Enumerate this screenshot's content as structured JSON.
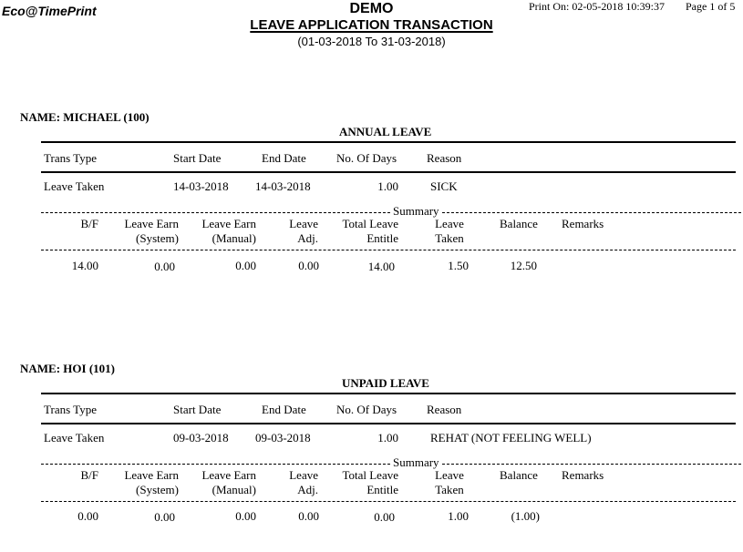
{
  "header": {
    "brand": "Eco@TimePrint",
    "company": "DEMO",
    "title": "LEAVE APPLICATION TRANSACTION",
    "period": "(01-03-2018 To 31-03-2018)",
    "print_on": "Print On: 02-05-2018 10:39:37",
    "page": "Page 1 of 5"
  },
  "columns": {
    "trans_type": "Trans Type",
    "start_date": "Start Date",
    "end_date": "End Date",
    "no_of_days": "No. Of Days",
    "reason": "Reason"
  },
  "summary_columns": {
    "label": "Summary",
    "bf": "B/F",
    "earn_sys_1": "Leave Earn",
    "earn_sys_2": "(System)",
    "earn_man_1": "Leave Earn",
    "earn_man_2": "(Manual)",
    "adj_1": "Leave",
    "adj_2": "Adj.",
    "entitle_1": "Total Leave",
    "entitle_2": "Entitle",
    "taken_1": "Leave",
    "taken_2": "Taken",
    "balance": "Balance",
    "remarks": "Remarks"
  },
  "employees": [
    {
      "name": "NAME: MICHAEL (100)",
      "leave_type": "ANNUAL LEAVE",
      "rows": [
        {
          "trans_type": "Leave Taken",
          "start_date": "14-03-2018",
          "end_date": "14-03-2018",
          "days": "1.00",
          "reason": "SICK"
        }
      ],
      "summary": {
        "bf": "14.00",
        "earn_system": "0.00",
        "earn_manual": "0.00",
        "adj": "0.00",
        "entitle": "14.00",
        "taken": "1.50",
        "balance": "12.50",
        "remarks": ""
      }
    },
    {
      "name": "NAME: HOI (101)",
      "leave_type": "UNPAID LEAVE",
      "rows": [
        {
          "trans_type": "Leave Taken",
          "start_date": "09-03-2018",
          "end_date": "09-03-2018",
          "days": "1.00",
          "reason": "REHAT (NOT FEELING WELL)"
        }
      ],
      "summary": {
        "bf": "0.00",
        "earn_system": "0.00",
        "earn_manual": "0.00",
        "adj": "0.00",
        "entitle": "0.00",
        "taken": "1.00",
        "balance": "(1.00)",
        "remarks": ""
      }
    }
  ]
}
